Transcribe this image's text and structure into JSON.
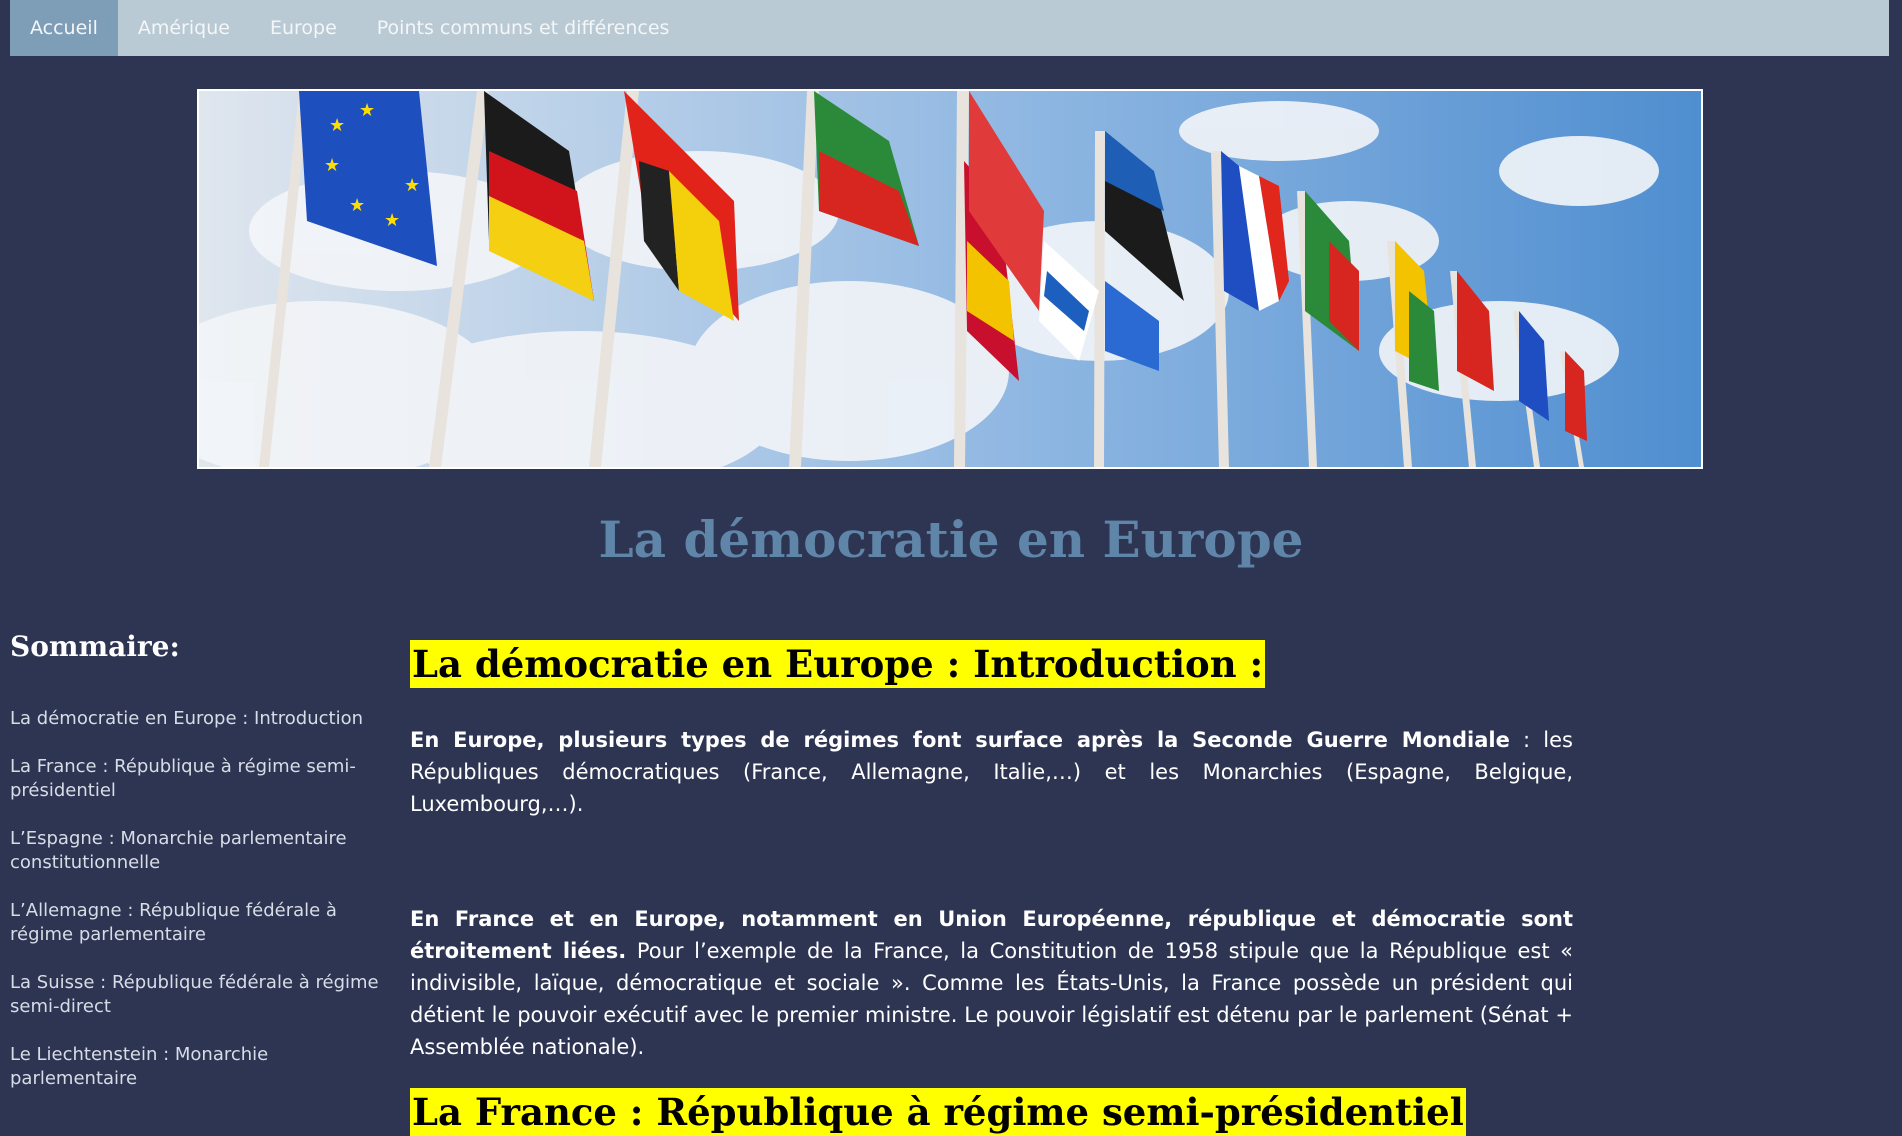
{
  "nav": {
    "items": [
      {
        "label": "Accueil",
        "active": true
      },
      {
        "label": "Amérique",
        "active": false
      },
      {
        "label": "Europe",
        "active": false
      },
      {
        "label": "Points communs et différences",
        "active": false
      }
    ]
  },
  "banner": {
    "alt": "flags-banner",
    "colors": {
      "sky": "#4f8ed0",
      "cloud": "#eef2f6",
      "pole": "#e8e3dc"
    }
  },
  "page_title": "La démocratie en Europe",
  "sidebar": {
    "title": "Sommaire:",
    "items": [
      "La démocratie en Europe : Introduction",
      "La France : République à régime semi-présidentiel",
      "L’Espagne : Monarchie parlementaire constitutionnelle",
      "L’Allemagne : République fédérale à régime parlementaire",
      "La Suisse : République fédérale à régime semi-direct",
      "Le Liechtenstein : Monarchie parlementaire"
    ]
  },
  "main": {
    "section1_title": "La démocratie en Europe : Introduction :",
    "para1_bold": "En Europe, plusieurs types de régimes font surface après la Seconde Guerre Mondiale",
    "para1_rest": " : les Républiques démocratiques (France, Allemagne, Italie,…) et les Monarchies (Espagne, Belgique, Luxembourg,…).",
    "para2_bold": "En France et en Europe, notamment en Union Européenne, république et démocratie sont étroitement liées.",
    "para2_rest": " Pour l’exemple de la France, la Constitution de 1958 stipule que la République est « indivisible, laïque, démocratique et sociale ». Comme les États-Unis, la France possède un président qui détient le pouvoir exécutif avec le premier ministre. Le pouvoir législatif est détenu par le parlement (Sénat + Assemblée nationale).",
    "section2_title": "La France : République à régime semi-présidentiel"
  },
  "colors": {
    "background": "#2e3553",
    "navbar": "#b9cad4",
    "nav_active": "#7e9db7",
    "title": "#5f86a9",
    "highlight": "#ffff00"
  }
}
